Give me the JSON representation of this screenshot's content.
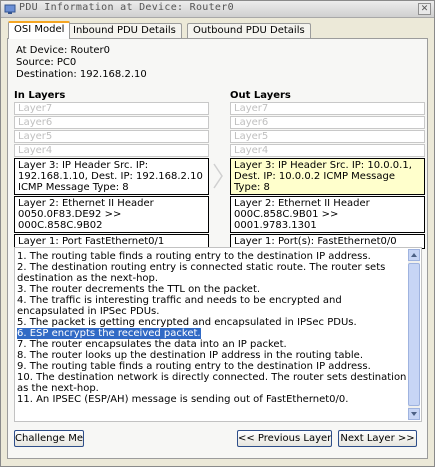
{
  "window": {
    "title": "PDU Information at Device: Router0",
    "close_glyph": "✕"
  },
  "tabs": [
    {
      "label": "OSI Model",
      "active": true
    },
    {
      "label": "Inbound PDU Details",
      "active": false
    },
    {
      "label": "Outbound PDU Details",
      "active": false
    }
  ],
  "info": {
    "device": "At Device: Router0",
    "source": "Source: PC0",
    "destination": "Destination: 192.168.2.10"
  },
  "in_layers": {
    "title": "In Layers",
    "items": [
      "Layer7",
      "Layer6",
      "Layer5",
      "Layer4",
      "Layer 3: IP Header Src. IP: 192.168.1.10, Dest. IP: 192.168.2.10 ICMP Message Type: 8",
      "Layer 2: Ethernet II Header 0050.0F83.DE92 >> 000C.858C.9B02",
      "Layer 1: Port FastEthernet0/1"
    ]
  },
  "out_layers": {
    "title": "Out Layers",
    "items": [
      "Layer7",
      "Layer6",
      "Layer5",
      "Layer4",
      "Layer 3: IP Header Src. IP: 10.0.0.1, Dest. IP: 10.0.0.2 ICMP Message Type: 8",
      "Layer 2: Ethernet II Header 000C.858C.9B01 >> 0001.9783.1301",
      "Layer 1: Port(s): FastEthernet0/0"
    ]
  },
  "steps": [
    "1. The routing table finds a routing entry to the destination IP address.",
    "2. The destination routing entry is connected static route. The router sets destination as the next-hop.",
    "3. The router decrements the TTL on the packet.",
    "4. The traffic is interesting traffic and needs to be encrypted and encapsulated in IPSec PDUs.",
    "5. The packet is getting encrypted and encapsulated in IPSec PDUs.",
    "6. ESP encrypts the received packet.",
    "7. The router encapsulates the data into an IP packet.",
    "8. The router looks up the destination IP address in the routing table.",
    "9. The routing table finds a routing entry to the destination IP address.",
    "10. The destination network is directly connected. The router sets destination as the next-hop.",
    "11. An IPSEC (ESP/AH) message is sending out of FastEthernet0/0."
  ],
  "selected_step": 5,
  "buttons": {
    "challenge": "Challenge Me",
    "previous": "<< Previous Layer",
    "next": "Next Layer >>"
  },
  "colors": {
    "highlight_layer": "#ffffcc",
    "selection": "#316ac5",
    "active_tab_accent": "#f5a623"
  },
  "icons": {
    "title": "network-device-icon",
    "close": "close-icon",
    "scroll_up": "scroll-up-arrow-icon",
    "scroll_down": "scroll-down-arrow-icon",
    "flow_arrow": "right-arrow-icon"
  }
}
